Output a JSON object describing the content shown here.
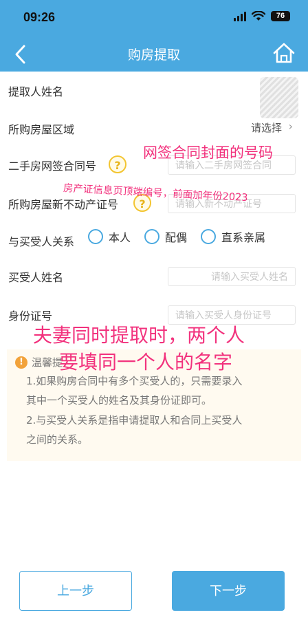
{
  "status_bar": {
    "time": "09:26",
    "battery": "76"
  },
  "nav": {
    "title": "购房提取"
  },
  "form": {
    "applicant_name": {
      "label": "提取人姓名"
    },
    "region": {
      "label": "所购房屋区域",
      "value": "请选择"
    },
    "contract_no": {
      "label": "二手房网签合同号",
      "placeholder": "请输入二手房网签合同"
    },
    "property_cert": {
      "label": "所购房屋新不动产证号",
      "placeholder": "请输入新不动产证号"
    },
    "relation": {
      "label": "与买受人关系",
      "options": [
        "本人",
        "配偶",
        "直系亲属"
      ]
    },
    "buyer_name": {
      "label": "买受人姓名",
      "placeholder": "请输入买受人姓名"
    },
    "buyer_id": {
      "label": "身份证号",
      "placeholder": "请输入买受人身份证号"
    }
  },
  "tips": {
    "title": "温馨提",
    "line1": "1.如果购房合同中有多个买受人的，只需要录入",
    "line2": "其中一个买受人的姓名及其身份证即可。",
    "line3": "2.与买受人关系是指申请提取人和合同上买受人",
    "line4": "之间的关系。"
  },
  "annotations": {
    "contract": "网签合同封面的号码",
    "cert": "房产证信息页顶端编号，前面加年份2023",
    "couple1": "夫妻同时提取时，两个人",
    "couple2": "要填同一个人的名字"
  },
  "buttons": {
    "prev": "上一步",
    "next": "下一步"
  },
  "colors": {
    "primary": "#4aa9e0",
    "annotation": "#f2327d",
    "help_icon": "#f3c531",
    "tips_bg": "#fffaf0"
  }
}
